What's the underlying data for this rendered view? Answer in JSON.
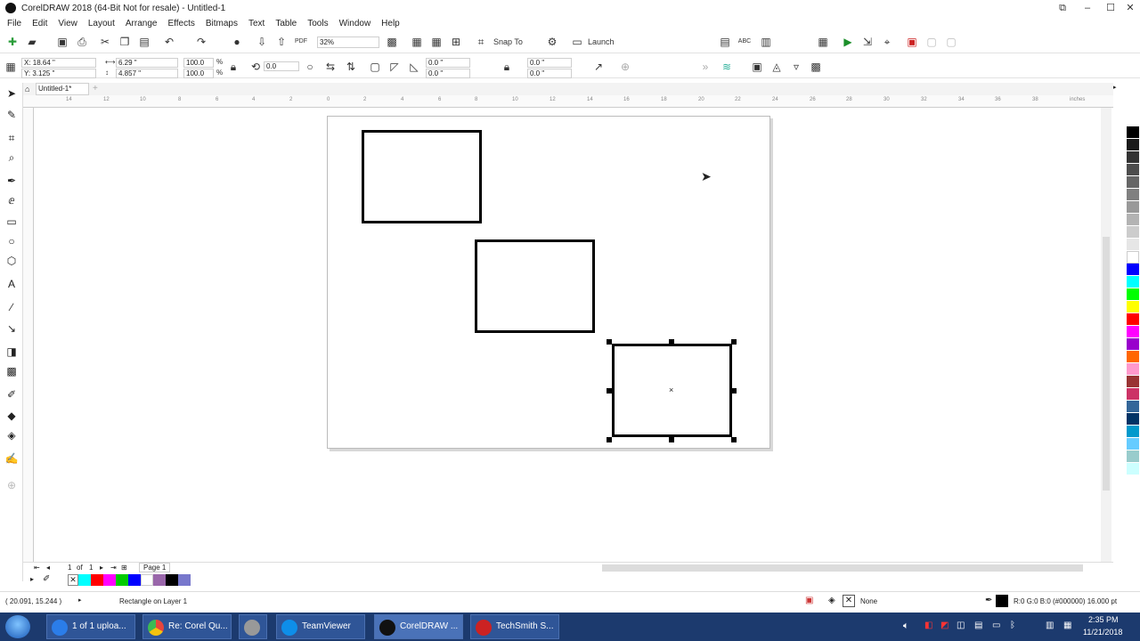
{
  "app": {
    "title": "CorelDRAW 2018 (64-Bit Not for resale) - Untitled-1",
    "accent": "#1a5ab8"
  },
  "menu": [
    "File",
    "Edit",
    "View",
    "Layout",
    "Arrange",
    "Effects",
    "Bitmaps",
    "Text",
    "Table",
    "Tools",
    "Window",
    "Help"
  ],
  "toolbar": {
    "zoom_value": "32%",
    "snap_label": "Snap To",
    "launch_label": "Launch",
    "pdf_label": "PDF"
  },
  "property_bar": {
    "x": "X: 18.64 \"",
    "y": "Y: 3.125 \"",
    "width": "6.29 \"",
    "height": "4.857 \"",
    "scale_x": "100.0",
    "scale_y": "100.0",
    "percent": "%",
    "rotation": "0.0",
    "corner_1": "0.0 \"",
    "corner_2": "0.0 \"",
    "corner_3": "0.0 \"",
    "corner_4": "0.0 \""
  },
  "doc_tab": {
    "label": "Untitled-1*"
  },
  "ruler": {
    "unit": "inches"
  },
  "page_nav": {
    "current": "1",
    "of_label": "of",
    "total": "1",
    "page_tab": "Page 1"
  },
  "status": {
    "coords": "( 20.091, 15.244 )",
    "object_info": "Rectangle on Layer 1",
    "fill_label": "None",
    "outline_info": "R:0 G:0 B:0 (#000000)  16.000 pt"
  },
  "palette_colors": [
    "#000000",
    "#1a1a1a",
    "#333333",
    "#4d4d4d",
    "#666666",
    "#808080",
    "#999999",
    "#b3b3b3",
    "#cccccc",
    "#e6e6e6",
    "#ffffff",
    "#0000ff",
    "#00ffff",
    "#00ff00",
    "#ffff00",
    "#ff0000",
    "#ff00ff",
    "#9900cc",
    "#ff6600",
    "#ff99cc",
    "#993333",
    "#cc3366",
    "#336699",
    "#003366",
    "#0099cc",
    "#66ccff",
    "#99cccc",
    "#ccffff"
  ],
  "doc_palette_colors": [
    "#00ffff",
    "#ff0000",
    "#ff00ff",
    "#00cc00",
    "#0000ff",
    "#ffffff",
    "#9966aa",
    "#000000",
    "#7777cc"
  ],
  "taskbar": {
    "items": [
      {
        "label": "1 of 1 uploa...",
        "color": "#2b7de9"
      },
      {
        "label": "Re: Corel Qu...",
        "color": "#e8453c"
      },
      {
        "label": "",
        "color": "#999999"
      },
      {
        "label": "TeamViewer",
        "color": "#0e8ee9"
      },
      {
        "label": "CorelDRAW ...",
        "color": "#111111"
      },
      {
        "label": "TechSmith S...",
        "color": "#cc2222"
      }
    ],
    "time": "2:35 PM",
    "date": "11/21/2018"
  }
}
